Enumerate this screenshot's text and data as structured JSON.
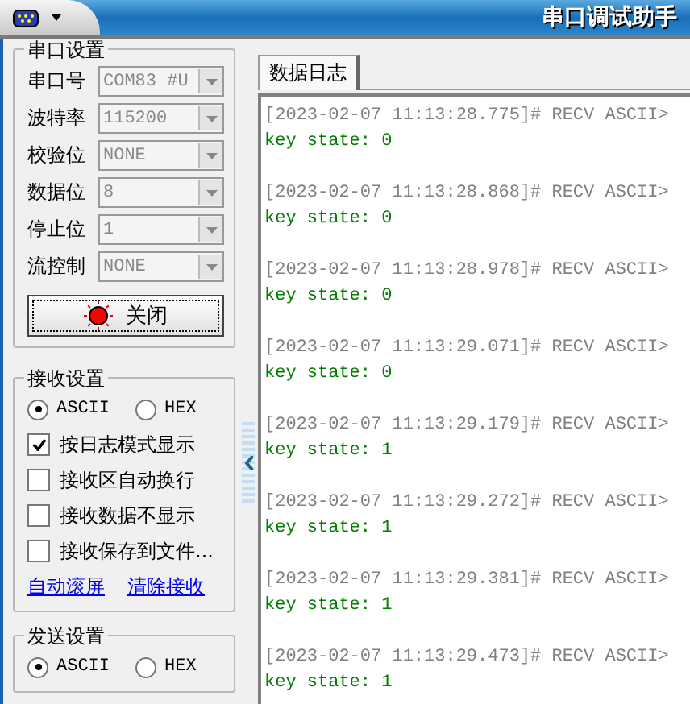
{
  "title_bar": {
    "title": "串口调试助手"
  },
  "serial_settings": {
    "title": "串口设置",
    "fields": [
      {
        "label": "串口号",
        "value": "COM83 #U",
        "disabled": true
      },
      {
        "label": "波特率",
        "value": "115200",
        "disabled": true
      },
      {
        "label": "校验位",
        "value": "NONE",
        "disabled": true
      },
      {
        "label": "数据位",
        "value": "8",
        "disabled": true
      },
      {
        "label": "停止位",
        "value": "1",
        "disabled": true
      },
      {
        "label": "流控制",
        "value": "NONE",
        "disabled": true
      }
    ],
    "button": {
      "label": "关闭",
      "on": true
    }
  },
  "receive_settings": {
    "title": "接收设置",
    "modes": [
      {
        "label": "ASCII",
        "selected": true
      },
      {
        "label": "HEX",
        "selected": false
      }
    ],
    "options": [
      {
        "label": "按日志模式显示",
        "checked": true
      },
      {
        "label": "接收区自动换行",
        "checked": false
      },
      {
        "label": "接收数据不显示",
        "checked": false
      },
      {
        "label": "接收保存到文件...",
        "checked": false
      }
    ],
    "links": [
      "自动滚屏",
      "清除接收"
    ]
  },
  "send_settings": {
    "title": "发送设置",
    "modes": [
      {
        "label": "ASCII",
        "selected": true
      },
      {
        "label": "HEX",
        "selected": false
      }
    ]
  },
  "tabs": [
    {
      "label": "数据日志",
      "selected": true
    }
  ],
  "log": [
    {
      "header": "[2023-02-07 11:13:28.775]# RECV ASCII>",
      "body": "key state: 0"
    },
    {
      "header": "[2023-02-07 11:13:28.868]# RECV ASCII>",
      "body": "key state: 0"
    },
    {
      "header": "[2023-02-07 11:13:28.978]# RECV ASCII>",
      "body": "key state: 0"
    },
    {
      "header": "[2023-02-07 11:13:29.071]# RECV ASCII>",
      "body": "key state: 0"
    },
    {
      "header": "[2023-02-07 11:13:29.179]# RECV ASCII>",
      "body": "key state: 1"
    },
    {
      "header": "[2023-02-07 11:13:29.272]# RECV ASCII>",
      "body": "key state: 1"
    },
    {
      "header": "[2023-02-07 11:13:29.381]# RECV ASCII>",
      "body": "key state: 1"
    },
    {
      "header": "[2023-02-07 11:13:29.473]# RECV ASCII>",
      "body": "key state: 1"
    }
  ]
}
